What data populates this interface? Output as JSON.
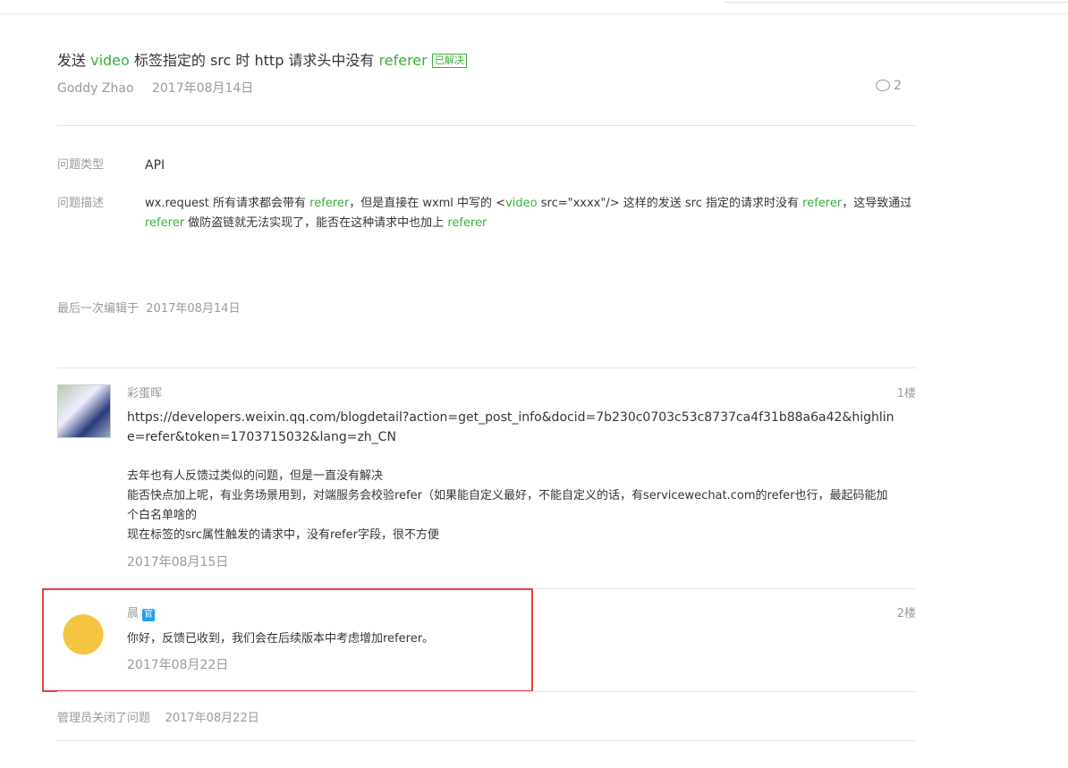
{
  "post": {
    "title_parts": [
      {
        "t": "发送 ",
        "g": false
      },
      {
        "t": "video",
        "g": true
      },
      {
        "t": " 标签指定的 src 时 http 请求头中没有 ",
        "g": false
      },
      {
        "t": "referer",
        "g": true
      }
    ],
    "status_badge": "已解决",
    "author": "Goddy Zhao",
    "date": "2017年08月14日",
    "comment_count": "2",
    "type_label": "问题类型",
    "type_value": "API",
    "desc_label": "问题描述",
    "desc_parts": [
      {
        "t": "wx.request 所有请求都会带有 ",
        "g": false
      },
      {
        "t": "referer",
        "g": true
      },
      {
        "t": "，但是直接在 wxml 中写的 <",
        "g": false
      },
      {
        "t": "video",
        "g": true
      },
      {
        "t": " src=\"xxxx\"/>  这样的发送 src 指定的请求时没有 ",
        "g": false
      },
      {
        "t": "referer",
        "g": true
      },
      {
        "t": "，这导致通过 ",
        "g": false
      },
      {
        "t": "referer",
        "g": true
      },
      {
        "t": " 做防盗链就无法实现了，能否在这种请求中也加上 ",
        "g": false
      },
      {
        "t": "referer",
        "g": true
      }
    ],
    "last_edit_label": "最后一次编辑于",
    "last_edit_date": "2017年08月14日"
  },
  "replies": [
    {
      "name": "彩蛋晖",
      "floor": "1楼",
      "lines": [
        "https://developers.weixin.qq.com/blogdetail?action=get_post_info&docid=7b230c0703c53c8737ca4f31b88a6a42&highline=refer&token=1703715032&lang=zh_CN",
        "",
        "去年也有人反馈过类似的问题，但是一直没有解决",
        "能否快点加上呢，有业务场景用到，对端服务会校验refer（如果能自定义最好，不能自定义的话，有servicewechat.com的refer也行，最起码能加个白名单啥的",
        "现在标签的src属性触发的请求中，没有refer字段，很不方便"
      ],
      "date": "2017年08月15日"
    },
    {
      "name": "晨",
      "official": "官",
      "floor": "2楼",
      "lines": [
        "你好，反馈已收到，我们会在后续版本中考虑增加referer。"
      ],
      "date": "2017年08月22日"
    }
  ],
  "closed": {
    "text": "管理员关闭了问题",
    "date": "2017年08月22日"
  }
}
